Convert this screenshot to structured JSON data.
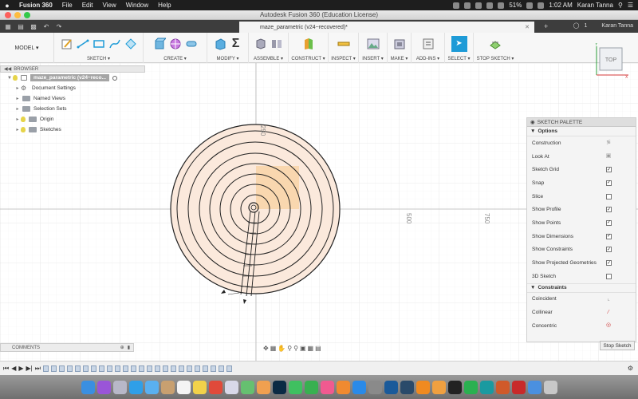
{
  "menubar": {
    "app_name": "Fusion 360",
    "menus": [
      "File",
      "Edit",
      "View",
      "Window",
      "Help"
    ],
    "battery": "51%",
    "time": "1:02 AM",
    "user": "Karan Tanna"
  },
  "window": {
    "title": "Autodesk Fusion 360 (Education License)"
  },
  "tabs": {
    "active_doc": "maze_parametric (v24~recovered)*",
    "notification_count": "1",
    "user": "Karan Tanna"
  },
  "toolbar": {
    "workspace": "MODEL ▾",
    "groups": {
      "sketch": "SKETCH ▾",
      "create": "CREATE ▾",
      "modify": "MODIFY ▾",
      "assemble": "ASSEMBLE ▾",
      "construct": "CONSTRUCT ▾",
      "inspect": "INSPECT ▾",
      "insert": "INSERT ▾",
      "make": "MAKE ▾",
      "addins": "ADD-INS ▾",
      "select": "SELECT ▾",
      "stop_sketch": "STOP SKETCH ▾"
    }
  },
  "browser": {
    "title": "BROWSER",
    "root": "maze_parametric (v24~reco...",
    "items": [
      "Document Settings",
      "Named Views",
      "Selection Sets",
      "Origin",
      "Sketches"
    ]
  },
  "viewcube": {
    "label": "TOP"
  },
  "sketch_palette": {
    "title": "SKETCH PALETTE",
    "options_label": "Options",
    "options": [
      {
        "label": "Construction",
        "kind": "icon",
        "icon": "construction-icon"
      },
      {
        "label": "Look At",
        "kind": "icon",
        "icon": "look-at-icon"
      },
      {
        "label": "Sketch Grid",
        "kind": "check",
        "checked": true
      },
      {
        "label": "Snap",
        "kind": "check",
        "checked": true
      },
      {
        "label": "Slice",
        "kind": "check",
        "checked": false
      },
      {
        "label": "Show Profile",
        "kind": "check",
        "checked": true
      },
      {
        "label": "Show Points",
        "kind": "check",
        "checked": true
      },
      {
        "label": "Show Dimensions",
        "kind": "check",
        "checked": true
      },
      {
        "label": "Show Constraints",
        "kind": "check",
        "checked": true
      },
      {
        "label": "Show Projected Geometries",
        "kind": "check",
        "checked": true
      },
      {
        "label": "3D Sketch",
        "kind": "check",
        "checked": false
      }
    ],
    "constraints_label": "Constraints",
    "constraints": [
      {
        "label": "Coincident",
        "icon": "coincident-icon"
      },
      {
        "label": "Collinear",
        "icon": "collinear-icon"
      },
      {
        "label": "Concentric",
        "icon": "concentric-icon"
      }
    ],
    "stop_button": "Stop Sketch"
  },
  "comments": {
    "title": "COMMENTS"
  },
  "canvas": {
    "axis_labels": {
      "top": "250",
      "x500": "500",
      "x750": "750"
    }
  },
  "colors": {
    "accent_blue": "#1e9bd7",
    "sketch_fill": "#fbe9dc",
    "profile_highlight": "#f7c98a"
  }
}
